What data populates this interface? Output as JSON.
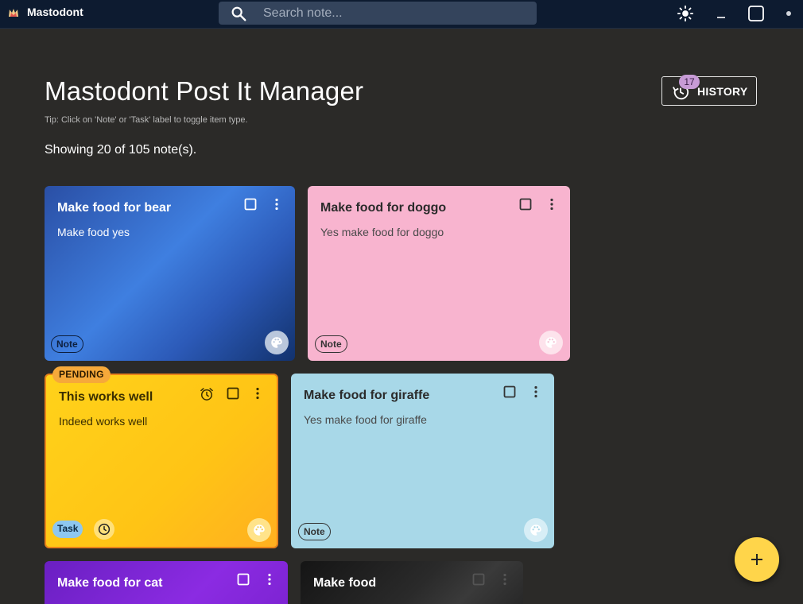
{
  "titlebar": {
    "app_name": "Mastodont",
    "search_placeholder": "Search note...",
    "minimize_glyph": "_"
  },
  "header": {
    "title": "Mastodont Post It Manager",
    "tip": "Tip: Click on 'Note' or 'Task' label to toggle item type.",
    "count": "Showing 20 of 105 note(s).",
    "history_label": "HISTORY",
    "history_count": "17"
  },
  "notes": [
    {
      "title": "Make food for bear",
      "body": "Make food yes",
      "type": "Note"
    },
    {
      "title": "Make food for doggo",
      "body": "Yes make food for doggo",
      "type": "Note"
    },
    {
      "title": "This works well",
      "body": "Indeed works well",
      "type": "Task",
      "status": "PENDING"
    },
    {
      "title": "Make food for giraffe",
      "body": "Yes make food for giraffe",
      "type": "Note"
    },
    {
      "title": "Make food for cat",
      "body": ""
    },
    {
      "title": "Make food",
      "body": ""
    }
  ],
  "icons": {
    "search": "search-icon",
    "theme": "sun-icon",
    "history": "history-icon",
    "palette": "palette-icon",
    "alarm": "alarm-icon",
    "clock": "clock-icon",
    "add": "plus-icon"
  },
  "colors": {
    "background": "#2b2a28",
    "titlebar": "#0d1b30",
    "pending": "#f6a93a",
    "fab": "#ffd54a",
    "badge": "#c79bd6"
  }
}
